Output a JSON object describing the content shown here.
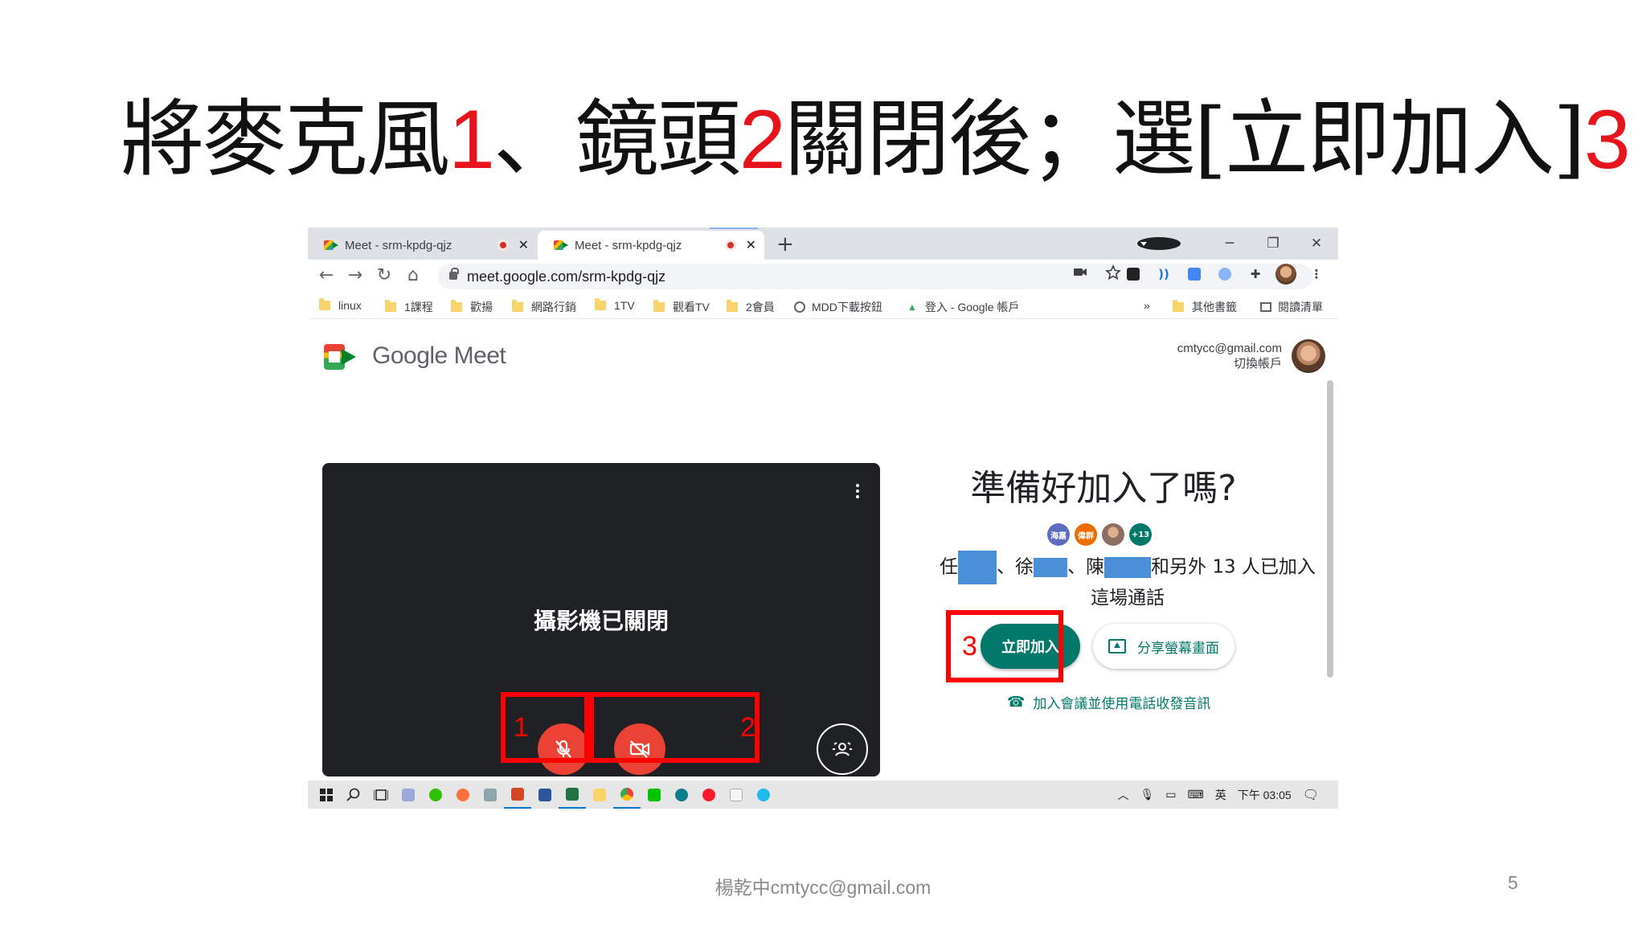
{
  "slide": {
    "title_parts": [
      "將麥克風",
      "1",
      "、鏡頭",
      "2",
      "關閉後；選[立即加入]",
      "3"
    ],
    "footer": "楊乾中cmtycc@gmail.com",
    "page_number": "5"
  },
  "browser": {
    "tabs": [
      {
        "title": "Meet - srm-kpdg-qjz",
        "active": false,
        "recording": true
      },
      {
        "title": "Meet - srm-kpdg-qjz",
        "active": true,
        "recording": true
      }
    ],
    "new_tab": "+",
    "window_controls": {
      "minimize": "─",
      "restore": "❐",
      "close": "✕"
    },
    "nav": {
      "back": "←",
      "forward": "→",
      "reload": "↻",
      "home": "⌂"
    },
    "url": "meet.google.com/srm-kpdg-qjz",
    "omnibox_icons": [
      "camera-icon",
      "star-icon"
    ],
    "extensions": [
      "ext-dark-icon",
      "ext-translate-icon",
      "ext-google-translate-icon",
      "ext-owl-icon",
      "puzzle-icon",
      "profile-icon",
      "kebab-menu-icon"
    ],
    "bookmarks": [
      {
        "label": "linux",
        "icon": "folder"
      },
      {
        "label": "1課程",
        "icon": "folder"
      },
      {
        "label": "歡揚",
        "icon": "folder"
      },
      {
        "label": "網路行銷",
        "icon": "folder"
      },
      {
        "label": "1TV",
        "icon": "folder"
      },
      {
        "label": "觀看TV",
        "icon": "folder"
      },
      {
        "label": "2會員",
        "icon": "folder"
      },
      {
        "label": "MDD下載按鈕",
        "icon": "globe"
      },
      {
        "label": "登入 - Google 帳戶",
        "icon": "drive"
      }
    ],
    "bookmarks_overflow": "»",
    "other_bookmarks": "其他書籤",
    "reading_list": "閱讀清單"
  },
  "meet": {
    "brand": "Google Meet",
    "account_email": "cmtycc@gmail.com",
    "switch_account": "切換帳戶",
    "camera_off_text": "攝影機已關閉",
    "ready_title": "準備好加入了嗎?",
    "participant_avatars": [
      {
        "label": "海嘉",
        "color": "#5c6bc0"
      },
      {
        "label": "偉群",
        "color": "#ef6c00"
      },
      {
        "label": "",
        "color": "#8d6e63"
      },
      {
        "label": "+13",
        "color": "#00796b"
      }
    ],
    "join_text_parts": [
      "任",
      "、徐",
      "、陳",
      "和另外 13 人已加入"
    ],
    "join_text_line2": "這場通話",
    "join_now": "立即加入",
    "present": "分享螢幕畫面",
    "phone_join": "加入會議並使用電話收發音訊"
  },
  "annotations": [
    "1",
    "2",
    "3"
  ],
  "taskbar": {
    "ime": "英",
    "time": "下午 03:05"
  },
  "colors": {
    "meet_teal": "#00796b",
    "mute_red": "#ea4335",
    "annotation_red": "#ff0000",
    "title_number_red": "#e8141b"
  }
}
